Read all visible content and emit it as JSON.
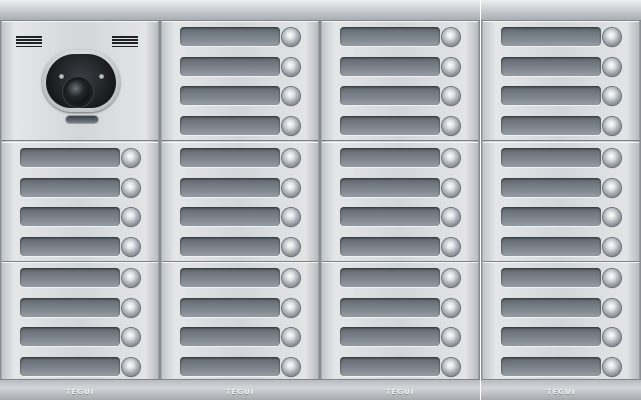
{
  "panel": {
    "type": "video-intercom-door-entry-panel",
    "columns": 4,
    "rows": 3,
    "buttons_per_module": 4,
    "camera_module": {
      "column": 1,
      "row": 1
    },
    "brand_text": [
      "TEGUI",
      "TEGUI",
      "TEGUI",
      "TEGUI"
    ],
    "total_call_buttons": 44
  },
  "colors": {
    "frame": "#c9cdd1",
    "nameplate": "#6f767d",
    "camera_housing": "#1b1d20",
    "brand_text": "#eef0f2"
  },
  "icons": [
    "camera-icon",
    "speaker-grille-icon",
    "call-button-icon"
  ]
}
